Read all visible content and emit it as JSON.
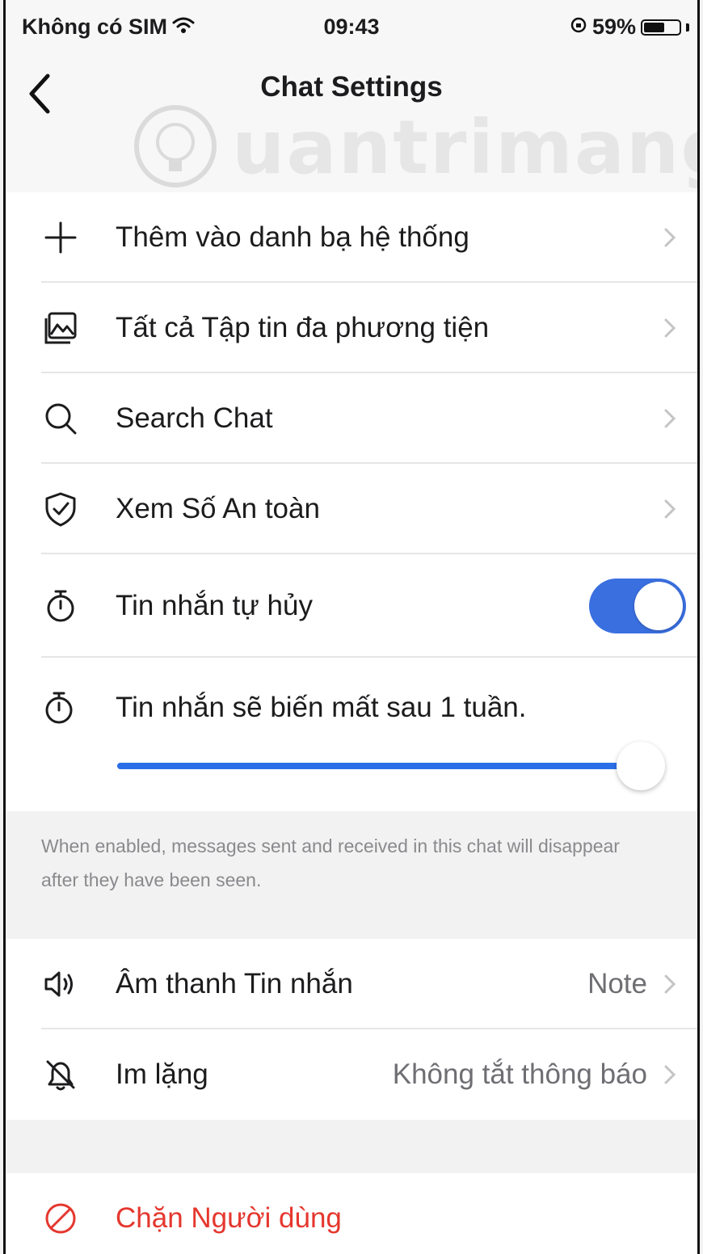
{
  "status_bar": {
    "carrier": "Không có SIM",
    "time": "09:43",
    "battery_percent": "59%",
    "battery_level": 0.59
  },
  "nav": {
    "title": "Chat Settings",
    "back_icon": "chevron-left-icon"
  },
  "watermark": {
    "text": "uantrimang"
  },
  "rows": [
    {
      "id": "add-contact",
      "icon": "plus-icon",
      "label": "Thêm vào danh bạ hệ thống"
    },
    {
      "id": "all-media",
      "icon": "photo-icon",
      "label": "Tất cả Tập tin đa phương tiện"
    },
    {
      "id": "search-chat",
      "icon": "search-icon",
      "label": "Search Chat"
    },
    {
      "id": "safety-number",
      "icon": "shield-check-icon",
      "label": "Xem Số An toàn"
    }
  ],
  "disappearing": {
    "toggle_label": "Tin nhắn tự hủy",
    "toggle_on": true,
    "slider_label": "Tin nhắn sẽ biến mất sau 1 tuần.",
    "slider_level": 1.0,
    "timer_icon": "timer-icon",
    "footnote": "When enabled, messages sent and received in this chat will disappear after they have been seen."
  },
  "sound_rows": [
    {
      "id": "message-sound",
      "icon": "speaker-icon",
      "label": "Âm thanh Tin nhắn",
      "value": "Note"
    },
    {
      "id": "mute",
      "icon": "bell-off-icon",
      "label": "Im lặng",
      "value": "Không tắt thông báo"
    }
  ],
  "block": {
    "icon": "block-icon",
    "label": "Chặn Người dùng"
  },
  "colors": {
    "accent": "#3a6fe0",
    "slider": "#2b6fe8",
    "danger": "#e5372e",
    "secondary_text": "#8a8a8e"
  }
}
